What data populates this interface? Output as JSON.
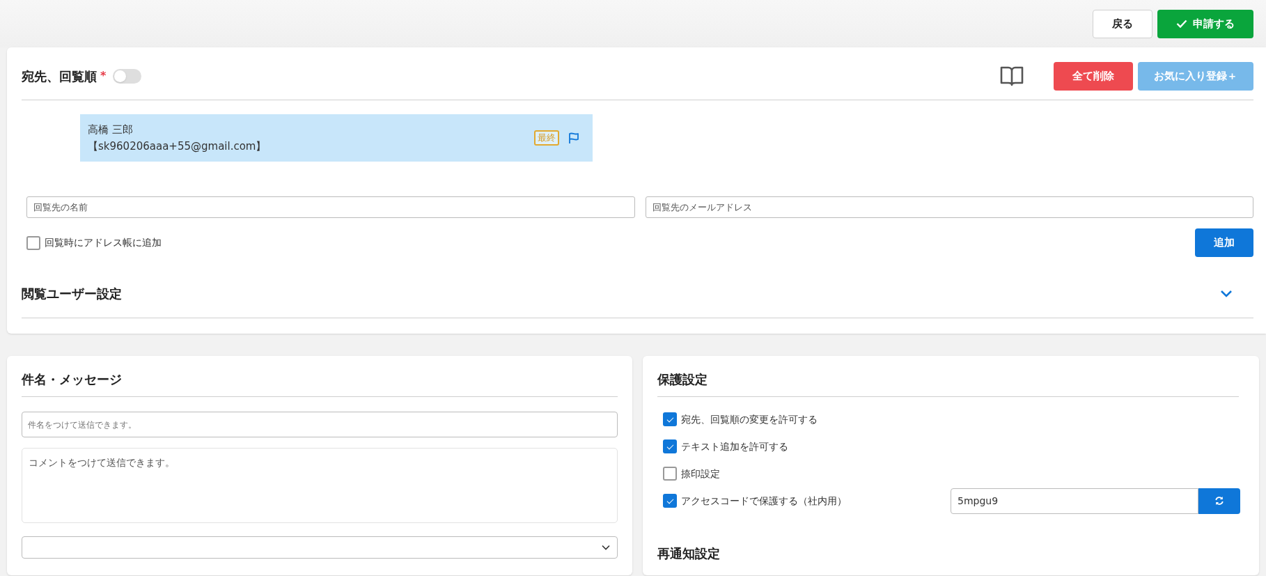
{
  "header": {
    "buttons": [
      {
        "label": "戻る",
        "kind": "secondary"
      },
      {
        "label": "申請する",
        "kind": "primary"
      }
    ]
  },
  "recipients_section": {
    "title": "宛先、回覧順",
    "required_mark": "*",
    "toggle": {
      "on": false
    },
    "buttons": [
      {
        "label": "全て削除",
        "kind": "danger"
      },
      {
        "label": "お気に入り登録＋",
        "kind": "favorite"
      }
    ],
    "recipients": [
      {
        "name": "高橋 三郎",
        "email": "【sk960206aaa+55@gmail.com】",
        "badge": "最終"
      }
    ],
    "name_field": {
      "placeholder": "回覧先の名前"
    },
    "email_field": {
      "placeholder": "回覧先のメールアドレス"
    },
    "add_to_address_book": {
      "label": "回覧時にアドレス帳に追加",
      "checked": false
    },
    "add_button": "追加",
    "viewer_settings": {
      "title": "閲覧ユーザー設定",
      "expanded": false
    }
  },
  "message_section": {
    "title": "件名・メッセージ",
    "subject": {
      "placeholder": "件名をつけて送信できます。"
    },
    "comment": {
      "placeholder": "コメントをつけて送信できます。"
    }
  },
  "protection_section": {
    "title": "保護設定",
    "options": [
      {
        "label": "宛先、回覧順の変更を許可する",
        "checked": true
      },
      {
        "label": "テキスト追加を許可する",
        "checked": true
      },
      {
        "label": "捺印設定",
        "checked": false
      },
      {
        "label": "アクセスコードで保護する（社内用）",
        "checked": true,
        "access_code": "5mpgu9"
      }
    ],
    "renotify": {
      "title": "再通知設定"
    }
  }
}
